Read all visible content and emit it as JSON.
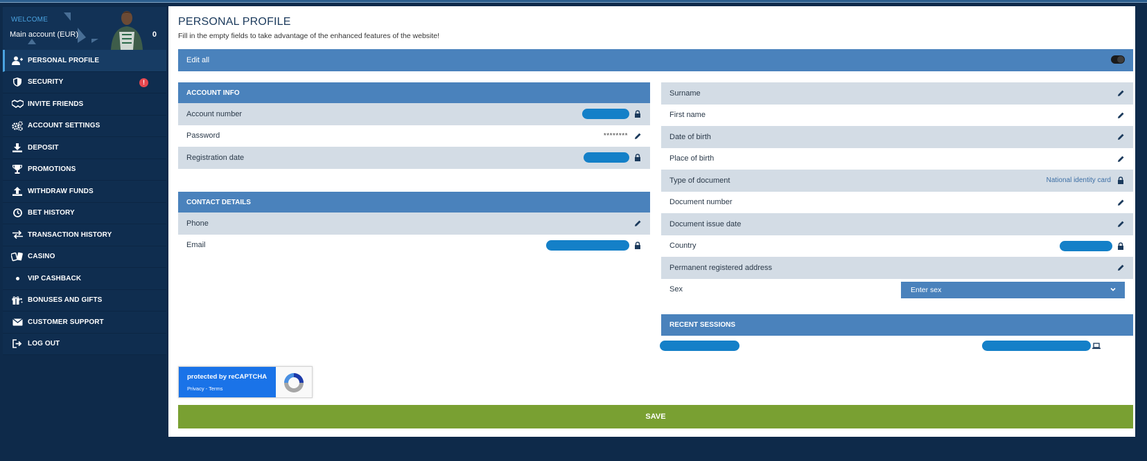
{
  "sidebar": {
    "welcome": "WELCOME",
    "account": "Main account (EUR)",
    "balance": "0",
    "items": [
      {
        "label": "PERSONAL PROFILE",
        "icon": "user-plus-icon"
      },
      {
        "label": "SECURITY",
        "icon": "shield-icon",
        "alert": "!"
      },
      {
        "label": "INVITE FRIENDS",
        "icon": "handshake-icon"
      },
      {
        "label": "ACCOUNT SETTINGS",
        "icon": "gears-icon"
      },
      {
        "label": "DEPOSIT",
        "icon": "download-icon"
      },
      {
        "label": "PROMOTIONS",
        "icon": "trophy-icon"
      },
      {
        "label": "WITHDRAW FUNDS",
        "icon": "upload-icon"
      },
      {
        "label": "BET HISTORY",
        "icon": "clock-icon"
      },
      {
        "label": "TRANSACTION HISTORY",
        "icon": "transfer-arrows-icon"
      },
      {
        "label": "CASINO",
        "icon": "cards-icon"
      },
      {
        "label": "VIP CASHBACK",
        "icon": "dot-icon"
      },
      {
        "label": "BONUSES AND GIFTS",
        "icon": "gift-icon"
      },
      {
        "label": "CUSTOMER SUPPORT",
        "icon": "envelope-icon"
      },
      {
        "label": "LOG OUT",
        "icon": "logout-icon"
      }
    ]
  },
  "main": {
    "title": "PERSONAL PROFILE",
    "subtitle": "Fill in the empty fields to take advantage of the enhanced features of the website!",
    "edit_all": "Edit all",
    "account_info": {
      "header": "ACCOUNT INFO",
      "rows": [
        {
          "label": "Account number"
        },
        {
          "label": "Password",
          "value": "********"
        },
        {
          "label": "Registration date"
        }
      ]
    },
    "contact": {
      "header": "CONTACT DETAILS",
      "rows": [
        {
          "label": "Phone"
        },
        {
          "label": "Email"
        }
      ]
    },
    "personal": {
      "rows": [
        {
          "label": "Surname"
        },
        {
          "label": "First name"
        },
        {
          "label": "Date of birth"
        },
        {
          "label": "Place of birth"
        },
        {
          "label": "Type of document",
          "value": "National identity card"
        },
        {
          "label": "Document number"
        },
        {
          "label": "Document issue date"
        },
        {
          "label": "Country"
        },
        {
          "label": "Permanent registered address"
        },
        {
          "label": "Sex"
        }
      ],
      "sex_placeholder": "Enter sex"
    },
    "sessions": {
      "header": "RECENT SESSIONS"
    },
    "recaptcha": {
      "line1": "protected by reCAPTCHA",
      "line2": "Privacy - Terms"
    },
    "save": "SAVE"
  },
  "colors": {
    "header_blue": "#4a82bc",
    "row_alt": "#d3dce5",
    "save_green": "#79a032",
    "sidebar_bg": "#0e2a4a",
    "redaction": "#1480c8"
  }
}
